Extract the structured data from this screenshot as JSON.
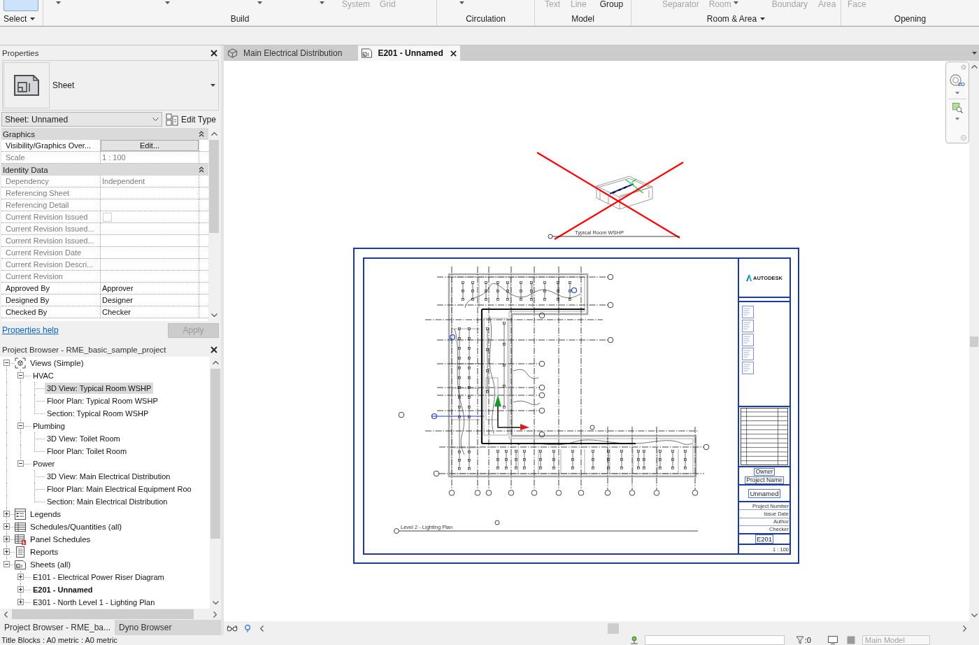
{
  "ribbon": {
    "panels": [
      {
        "title": "Select",
        "dropdown": true,
        "items": [
          {
            "kind": "tile"
          }
        ]
      },
      {
        "title": "Build",
        "dropdown": false,
        "items": [
          {
            "kind": "caret"
          },
          {
            "kind": "caret"
          },
          {
            "kind": "caret"
          },
          {
            "kind": "caret"
          },
          {
            "kind": "label",
            "label": "System",
            "disabled": true
          },
          {
            "kind": "label",
            "label": "Grid",
            "disabled": true
          }
        ]
      },
      {
        "title": "Circulation",
        "dropdown": false,
        "items": [
          {
            "kind": "caret"
          }
        ]
      },
      {
        "title": "Model",
        "dropdown": false,
        "items": [
          {
            "kind": "label",
            "label": "Text",
            "disabled": true
          },
          {
            "kind": "label",
            "label": "Line",
            "disabled": true
          },
          {
            "kind": "label",
            "label": "Group",
            "disabled": false
          }
        ]
      },
      {
        "title": "Room & Area",
        "dropdown": true,
        "items": [
          {
            "kind": "label",
            "label": "Separator",
            "disabled": true
          },
          {
            "kind": "label",
            "label": "Room",
            "disabled": true
          },
          {
            "kind": "caret"
          },
          {
            "kind": "label",
            "label": "Boundary",
            "disabled": true
          },
          {
            "kind": "label",
            "label": "Area",
            "disabled": true
          }
        ]
      },
      {
        "title": "Opening",
        "dropdown": false,
        "items": [
          {
            "kind": "label",
            "label": "Face",
            "disabled": true
          }
        ]
      }
    ]
  },
  "properties": {
    "title": "Properties",
    "type_selector": {
      "label": "Sheet"
    },
    "instance_filter": {
      "value": "Sheet: Unnamed"
    },
    "edit_type_button": "Edit Type",
    "groups": [
      {
        "title": "Graphics",
        "expanded": true,
        "rows": [
          {
            "kind": "button",
            "name": "Visibility/Graphics Over...",
            "value": "Edit...",
            "disabled": false
          },
          {
            "kind": "text",
            "name": "Scale",
            "value": "1 : 100",
            "disabled": true
          }
        ]
      },
      {
        "title": "Identity Data",
        "expanded": true,
        "rows": [
          {
            "kind": "text",
            "name": "Dependency",
            "value": "Independent",
            "disabled": true
          },
          {
            "kind": "text",
            "name": "Referencing Sheet",
            "disabled": true
          },
          {
            "kind": "text",
            "name": "Referencing Detail",
            "disabled": true
          },
          {
            "kind": "checkbox",
            "name": "Current Revision Issued",
            "checked": false,
            "disabled": true
          },
          {
            "kind": "text",
            "name": "Current Revision Issued...",
            "disabled": true
          },
          {
            "kind": "text",
            "name": "Current Revision Issued...",
            "disabled": true
          },
          {
            "kind": "text",
            "name": "Current Revision Date",
            "disabled": true
          },
          {
            "kind": "text",
            "name": "Current Revision Descri...",
            "disabled": true
          },
          {
            "kind": "text",
            "name": "Current Revision",
            "disabled": true
          },
          {
            "kind": "text",
            "name": "Approved By",
            "value": "Approver",
            "disabled": false
          },
          {
            "kind": "text",
            "name": "Designed By",
            "value": "Designer",
            "disabled": false
          },
          {
            "kind": "text",
            "name": "Checked By",
            "value": "Checker",
            "disabled": false
          }
        ]
      }
    ],
    "help_link": "Properties help",
    "apply_button": {
      "label": "Apply",
      "disabled": true
    }
  },
  "project_browser": {
    "title": "Project Browser - RME_basic_sample_project",
    "tree": [
      {
        "label": "Views (Simple)",
        "kind": "views",
        "expanded": true,
        "selected": false,
        "children": [
          {
            "label": "HVAC",
            "expanded": true,
            "selected": false,
            "children": [
              {
                "label": "3D View: Typical Room WSHP",
                "selected": true
              },
              {
                "label": "Floor Plan: Typical Room WSHP",
                "selected": false
              },
              {
                "label": "Section: Typical Room WSHP",
                "selected": false
              }
            ]
          },
          {
            "label": "Plumbing",
            "expanded": true,
            "selected": false,
            "children": [
              {
                "label": "3D View: Toilet Room",
                "selected": false
              },
              {
                "label": "Floor Plan: Toilet Room",
                "selected": false
              }
            ]
          },
          {
            "label": "Power",
            "expanded": true,
            "selected": false,
            "children": [
              {
                "label": "3D View: Main Electrical Distribution",
                "selected": false
              },
              {
                "label": "Floor Plan: Main Electrical Equipment Roo",
                "selected": false
              },
              {
                "label": "Section: Main Electrical Distribution",
                "selected": false
              }
            ]
          }
        ]
      },
      {
        "label": "Legends",
        "kind": "legends",
        "expanded": false,
        "selected": false
      },
      {
        "label": "Schedules/Quantities (all)",
        "kind": "schedules",
        "expanded": false,
        "selected": false
      },
      {
        "label": "Panel Schedules",
        "kind": "panelschedules",
        "expanded": false,
        "selected": false
      },
      {
        "label": "Reports",
        "kind": "reports",
        "expanded": false,
        "selected": false
      },
      {
        "label": "Sheets (all)",
        "kind": "sheets",
        "expanded": true,
        "selected": false,
        "children": [
          {
            "label": "E101 - Electrical Power Riser Diagram",
            "expanded": false,
            "selected": false,
            "current": false
          },
          {
            "label": "E201 - Unnamed",
            "expanded": false,
            "selected": false,
            "current": true
          },
          {
            "label": "E301 - North Level 1 - Lighting Plan",
            "expanded": false,
            "selected": false,
            "current": false
          }
        ]
      }
    ]
  },
  "panel_tabs": [
    {
      "label": "Project Browser - RME_ba...",
      "selected": true
    },
    {
      "label": "Dyno Browser",
      "selected": false
    }
  ],
  "view_tabs": [
    {
      "kind": "model",
      "label": "Main Electrical Distribution",
      "selected": false
    },
    {
      "kind": "sheet",
      "label": "E201 - Unnamed",
      "selected": true
    }
  ],
  "nav_bar": {
    "wheel_label": "2D"
  },
  "sheet": {
    "view_3d": {
      "caption": "Typical Room WSHP"
    },
    "plan_view": {
      "caption": "Level 2 - Lighting Plan"
    },
    "title_block": {
      "logo": "AUTODESK",
      "owner": "Owner",
      "project_name": "Project Name",
      "sheet_name": "Unnamed",
      "fields": [
        "Project Number",
        "Issue Date",
        "Author",
        "Checker"
      ],
      "sheet_number": "E201",
      "scale": "1 : 100"
    }
  },
  "status_bar": {
    "text": "Title Blocks : A0 metric : A0 metric",
    "filter_count": ":0",
    "active_model": {
      "value": "Main Model",
      "disabled": true
    }
  }
}
